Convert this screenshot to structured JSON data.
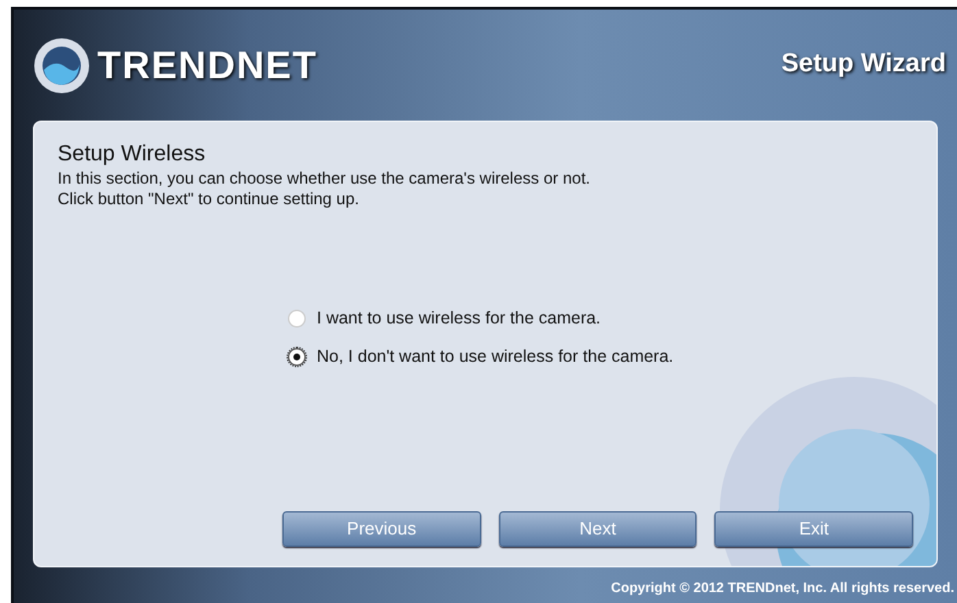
{
  "header": {
    "logo": "TRENDNET",
    "title": "Setup Wizard"
  },
  "section": {
    "heading": "Setup Wireless",
    "lines": [
      "In this section, you can choose whether use the camera's wireless or not.",
      "Click button \"Next\" to continue setting up."
    ]
  },
  "options": [
    {
      "label": "I want to use wireless for the camera.",
      "selected": false
    },
    {
      "label": "No, I don't want to use wireless for the camera.",
      "selected": true
    }
  ],
  "buttons": [
    "Previous",
    "Next",
    "Exit"
  ],
  "footer": "Copyright © 2012 TRENDnet, Inc. All rights reserved."
}
